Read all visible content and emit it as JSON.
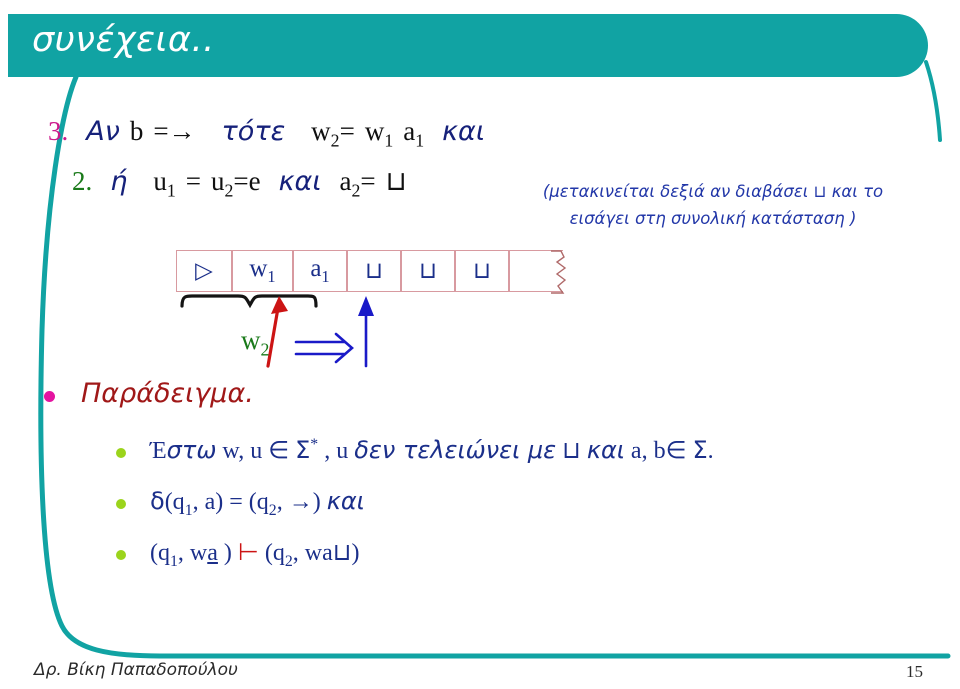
{
  "slide": {
    "title": "συνέχεια..",
    "page_number": "15",
    "author": "Δρ. Βίκη Παπαδοπούλου",
    "accent_color": "#11a3a3",
    "text_color": "#1b2f8a"
  },
  "steps": [
    {
      "marker": "3.",
      "marker_color": "#cc1a8c",
      "parts": [
        "Αν",
        "b",
        "=→",
        "τότε",
        "w",
        "2",
        "=",
        "w",
        "1",
        "a",
        "1",
        "και"
      ],
      "text": "Αν b =→ τότε w2= w1 a1 και"
    },
    {
      "marker": "2.",
      "marker_color": "#1a7a1a",
      "text": "ή u1 = u2=e και a2= ⊔"
    }
  ],
  "note": {
    "line1": "(μετακινείται δεξιά αν διαβάσει ⊔ και το",
    "line2": "εισάγει στη συνολική   κατάσταση )"
  },
  "tape": {
    "cells": [
      {
        "label": "▷",
        "kind": "start"
      },
      {
        "label": "w",
        "sub": "1",
        "kind": "symbol"
      },
      {
        "label": "a",
        "sub": "1",
        "kind": "symbol"
      },
      {
        "label": "⊔",
        "kind": "blank"
      },
      {
        "label": "⊔",
        "kind": "blank"
      },
      {
        "label": "⊔",
        "kind": "blank"
      },
      {
        "label": "",
        "kind": "torn"
      }
    ],
    "brace_label": "w",
    "brace_label_sub": "2",
    "brace_label_color": "#1a7a1a",
    "head_arrow_color": "#cc1414",
    "move_arrow_glyph": "⇒",
    "move_arrow_color": "#1a1ac8",
    "next_head_arrow_color": "#1a1ac8"
  },
  "bullets": [
    {
      "level": 1,
      "bullet_color": "#e413a0",
      "text": "Παράδειγμα.",
      "text_color": "#a01818"
    },
    {
      "level": 2,
      "bullet_color": "#9bd41c",
      "text": "Έστω w, u ∈ Σ* , u δεν τελειώνει με ⊔ και a, b∈ Σ.",
      "text_color": "#1b2f8a"
    },
    {
      "level": 2,
      "bullet_color": "#9bd41c",
      "text": "δ(q1, a) = (q2, →) και",
      "text_color": "#1b2f8a"
    },
    {
      "level": 2,
      "bullet_color": "#9bd41c",
      "text": "(q1, wa ) ⊢ (q2, wa⊔)",
      "text_color": "#1b2f8a"
    }
  ]
}
